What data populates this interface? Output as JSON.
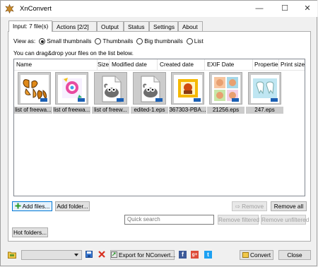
{
  "window": {
    "title": "XnConvert",
    "minimize": "—",
    "maximize": "☐",
    "close": "✕"
  },
  "tabs": [
    {
      "label": "Input: 7 file(s)"
    },
    {
      "label": "Actions [2/2]"
    },
    {
      "label": "Output"
    },
    {
      "label": "Status"
    },
    {
      "label": "Settings"
    },
    {
      "label": "About"
    }
  ],
  "view": {
    "label": "View as:",
    "options": [
      "Small thumbnails",
      "Thumbnails",
      "Big thumbnails",
      "List"
    ],
    "selected": "Small thumbnails"
  },
  "hint": "You can drag&drop your files on the list below.",
  "columns": [
    "Name",
    "Size",
    "Modified date",
    "Created date",
    "EXIF Date",
    "Propertie",
    "Print size"
  ],
  "files": [
    {
      "name": "list of freewa...",
      "icon": "butterfly-icon"
    },
    {
      "name": "list of freewa...",
      "icon": "photo-icon"
    },
    {
      "name": "list of freew...",
      "icon": "gimp-icon"
    },
    {
      "name": "edited-1.eps",
      "icon": "gimp-icon"
    },
    {
      "name": "367303-PBA...",
      "icon": "gift-icon"
    },
    {
      "name": "21256.eps",
      "icon": "faces-icon"
    },
    {
      "name": "247.eps",
      "icon": "teeth-icon"
    }
  ],
  "buttons": {
    "add_files": "Add files...",
    "add_folder": "Add folder...",
    "remove": "Remove",
    "remove_all": "Remove all",
    "remove_filtered": "Remove filtered",
    "remove_unfiltered": "Remove unfiltered",
    "hot_folders": "Hot folders...",
    "export": "Export for NConvert...",
    "convert": "Convert",
    "close": "Close"
  },
  "search": {
    "placeholder": "Quick search"
  }
}
